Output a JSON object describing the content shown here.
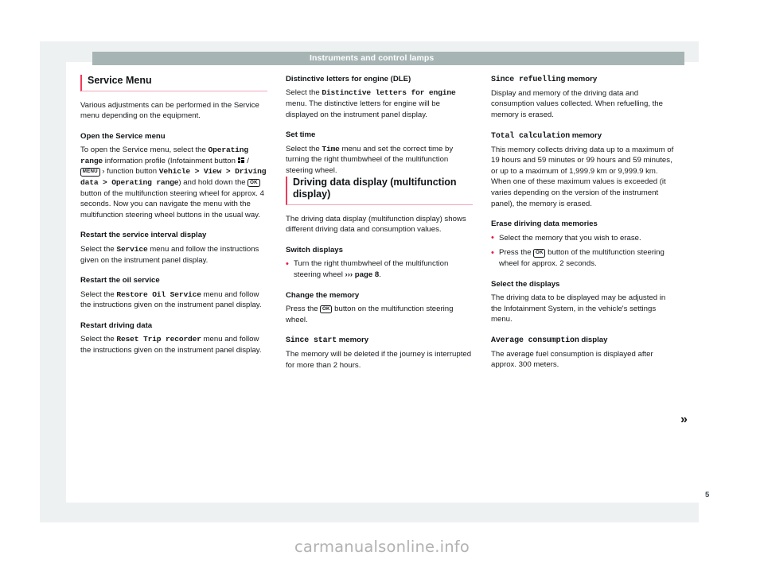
{
  "header": {
    "running_title": "Instruments and control lamps"
  },
  "page": {
    "number": "5",
    "continuation_marker": "»",
    "watermark": "carmanualsonline.info"
  },
  "icons": {
    "infotainment_button": "grid-button-icon",
    "menu_button_label": "MENU",
    "ok_button_label": "OK",
    "chevron": "›",
    "cross_reference_arrow": "›››"
  },
  "columns": [
    {
      "id": "column-left",
      "blocks": [
        {
          "type": "section-title",
          "text": "Service Menu"
        },
        {
          "type": "paragraph",
          "runs": [
            {
              "t": "Various adjustments can be performed in the Service menu depending on the equipment."
            }
          ]
        },
        {
          "type": "subheading",
          "text": "Open the Service menu"
        },
        {
          "type": "paragraph",
          "runs": [
            {
              "t": "To open the Service menu, select the "
            },
            {
              "t": "Operating range",
              "style": "mono"
            },
            {
              "t": " information profile (Infotainment button "
            },
            {
              "t": "",
              "style": "icon-grid"
            },
            {
              "t": " / "
            },
            {
              "t": "MENU",
              "style": "key"
            },
            {
              "t": " › function button "
            },
            {
              "t": "Vehicle > View > Driving data > Operating range",
              "style": "mono"
            },
            {
              "t": ") and hold down the "
            },
            {
              "t": "OK",
              "style": "key"
            },
            {
              "t": " button of the multifunction steering wheel for approx. 4 seconds. Now you can navigate the menu with the multifunction steering wheel buttons in the usual way."
            }
          ]
        },
        {
          "type": "subheading",
          "text": "Restart the service interval display"
        },
        {
          "type": "paragraph",
          "runs": [
            {
              "t": "Select the "
            },
            {
              "t": "Service",
              "style": "mono"
            },
            {
              "t": " menu and follow the instructions given on the instrument panel display."
            }
          ]
        },
        {
          "type": "subheading",
          "text": "Restart the oil service"
        },
        {
          "type": "paragraph",
          "runs": [
            {
              "t": "Select the "
            },
            {
              "t": "Restore Oil Service",
              "style": "mono"
            },
            {
              "t": " menu and follow the instructions given on the instrument panel display."
            }
          ]
        },
        {
          "type": "subheading",
          "text": "Restart driving data"
        },
        {
          "type": "paragraph",
          "runs": [
            {
              "t": "Select the "
            },
            {
              "t": "Reset Trip recorder",
              "style": "mono"
            },
            {
              "t": " menu and follow the instructions given on the instrument panel display."
            }
          ]
        }
      ]
    },
    {
      "id": "column-middle",
      "blocks": [
        {
          "type": "subheading",
          "text": "Distinctive letters for engine (DLE)"
        },
        {
          "type": "paragraph",
          "runs": [
            {
              "t": "Select the "
            },
            {
              "t": "Distinctive letters for engine",
              "style": "mono"
            },
            {
              "t": " menu. The distinctive letters for engine will be displayed on the instrument panel display."
            }
          ]
        },
        {
          "type": "subheading",
          "text": "Set time"
        },
        {
          "type": "paragraph",
          "runs": [
            {
              "t": "Select the "
            },
            {
              "t": "Time",
              "style": "mono"
            },
            {
              "t": " menu and set the correct time by turning the right thumbwheel of the multifunction steering wheel."
            }
          ]
        },
        {
          "type": "section-title",
          "text": "Driving data display (multifunction display)"
        },
        {
          "type": "paragraph",
          "runs": [
            {
              "t": "The driving data display (multifunction display) shows different driving data and consumption values."
            }
          ]
        },
        {
          "type": "subheading",
          "text": "Switch displays"
        },
        {
          "type": "bullets",
          "items": [
            {
              "runs": [
                {
                  "t": "Turn the right thumbwheel of the multifunction steering wheel "
                },
                {
                  "t": "››› page 8",
                  "style": "ref"
                },
                {
                  "t": "."
                }
              ]
            }
          ]
        },
        {
          "type": "subheading",
          "text": "Change the memory"
        },
        {
          "type": "paragraph",
          "runs": [
            {
              "t": "Press the "
            },
            {
              "t": "OK",
              "style": "key"
            },
            {
              "t": " button on the multifunction steering wheel."
            }
          ]
        },
        {
          "type": "subheading-mono",
          "mono_text": "Since start",
          "plain_text": " memory"
        },
        {
          "type": "paragraph",
          "runs": [
            {
              "t": "The memory will be deleted if the journey is interrupted for more than 2 hours."
            }
          ]
        }
      ]
    },
    {
      "id": "column-right",
      "blocks": [
        {
          "type": "subheading-mono",
          "mono_text": "Since refuelling",
          "plain_text": " memory"
        },
        {
          "type": "paragraph",
          "runs": [
            {
              "t": "Display and memory of the driving data and consumption values collected. When refuelling, the memory is erased."
            }
          ]
        },
        {
          "type": "subheading-mono",
          "mono_text": "Total calculation",
          "plain_text": " memory"
        },
        {
          "type": "paragraph",
          "runs": [
            {
              "t": "This memory collects driving data up to a maximum of 19 hours and 59 minutes or 99 hours and 59 minutes, or up to a maximum of 1,999.9 km or 9,999.9 km. When one of these maximum values is exceeded (it varies depending on the version of the instrument panel), the memory is erased."
            }
          ]
        },
        {
          "type": "subheading",
          "text": "Erase diriving data memories"
        },
        {
          "type": "bullets",
          "items": [
            {
              "runs": [
                {
                  "t": "Select the memory that you wish to erase."
                }
              ]
            },
            {
              "runs": [
                {
                  "t": "Press the "
                },
                {
                  "t": "OK",
                  "style": "key"
                },
                {
                  "t": " button of the multifunction steering wheel for approx. 2 seconds."
                }
              ]
            }
          ]
        },
        {
          "type": "subheading",
          "text": "Select the displays"
        },
        {
          "type": "paragraph",
          "runs": [
            {
              "t": "The driving data to be displayed may be adjusted in the Infotainment System, in the vehicle's settings menu."
            }
          ]
        },
        {
          "type": "subheading-mono",
          "mono_text": "Average consumption",
          "plain_text": " display"
        },
        {
          "type": "paragraph",
          "runs": [
            {
              "t": "The average fuel consumption is displayed after approx. 300 meters."
            }
          ]
        }
      ]
    }
  ]
}
